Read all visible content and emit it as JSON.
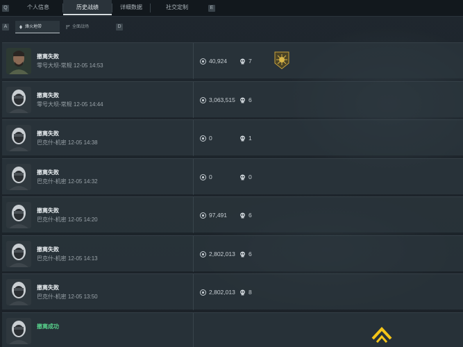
{
  "tabs": {
    "left_key": "Q",
    "right_key": "E",
    "items": [
      {
        "label": "个人信息"
      },
      {
        "label": "历史战绩"
      },
      {
        "label": "详细数据"
      },
      {
        "label": "社交定制"
      }
    ]
  },
  "subtabs": {
    "left_key": "A",
    "right_key": "D",
    "items": [
      {
        "label": "烽火地带"
      },
      {
        "label": "全面战场"
      }
    ]
  },
  "matches": [
    {
      "title": "撤离失败",
      "subtitle": "零号大坝-常规 12-05 14:53",
      "value": "40,924",
      "kills": "7",
      "has_badge": true
    },
    {
      "title": "撤离失败",
      "subtitle": "零号大坝-常规 12-05 14:44",
      "value": "3,063,515",
      "kills": "6"
    },
    {
      "title": "撤离失败",
      "subtitle": "巴克什-机密 12-05 14:38",
      "value": "0",
      "kills": "1"
    },
    {
      "title": "撤离失败",
      "subtitle": "巴克什-机密 12-05 14:32",
      "value": "0",
      "kills": "0"
    },
    {
      "title": "撤离失败",
      "subtitle": "巴克什-机密 12-05 14:20",
      "value": "97,491",
      "kills": "6"
    },
    {
      "title": "撤离失败",
      "subtitle": "巴克什-机密 12-05 14:13",
      "value": "2,802,013",
      "kills": "6"
    },
    {
      "title": "撤离失败",
      "subtitle": "巴克什-机密 12-05 13:50",
      "value": "2,802,013",
      "kills": "8"
    },
    {
      "title": "撤离成功",
      "subtitle": "",
      "value": "",
      "kills": ""
    }
  ],
  "icons": {
    "value_icon": "coin-icon",
    "kills_icon": "skull-icon",
    "badge_icon": "rank-badge-icon",
    "scroll_icon": "chevron-up-icon"
  },
  "colors": {
    "success": "#58d28c",
    "accent_arrow": "#f5c518"
  }
}
